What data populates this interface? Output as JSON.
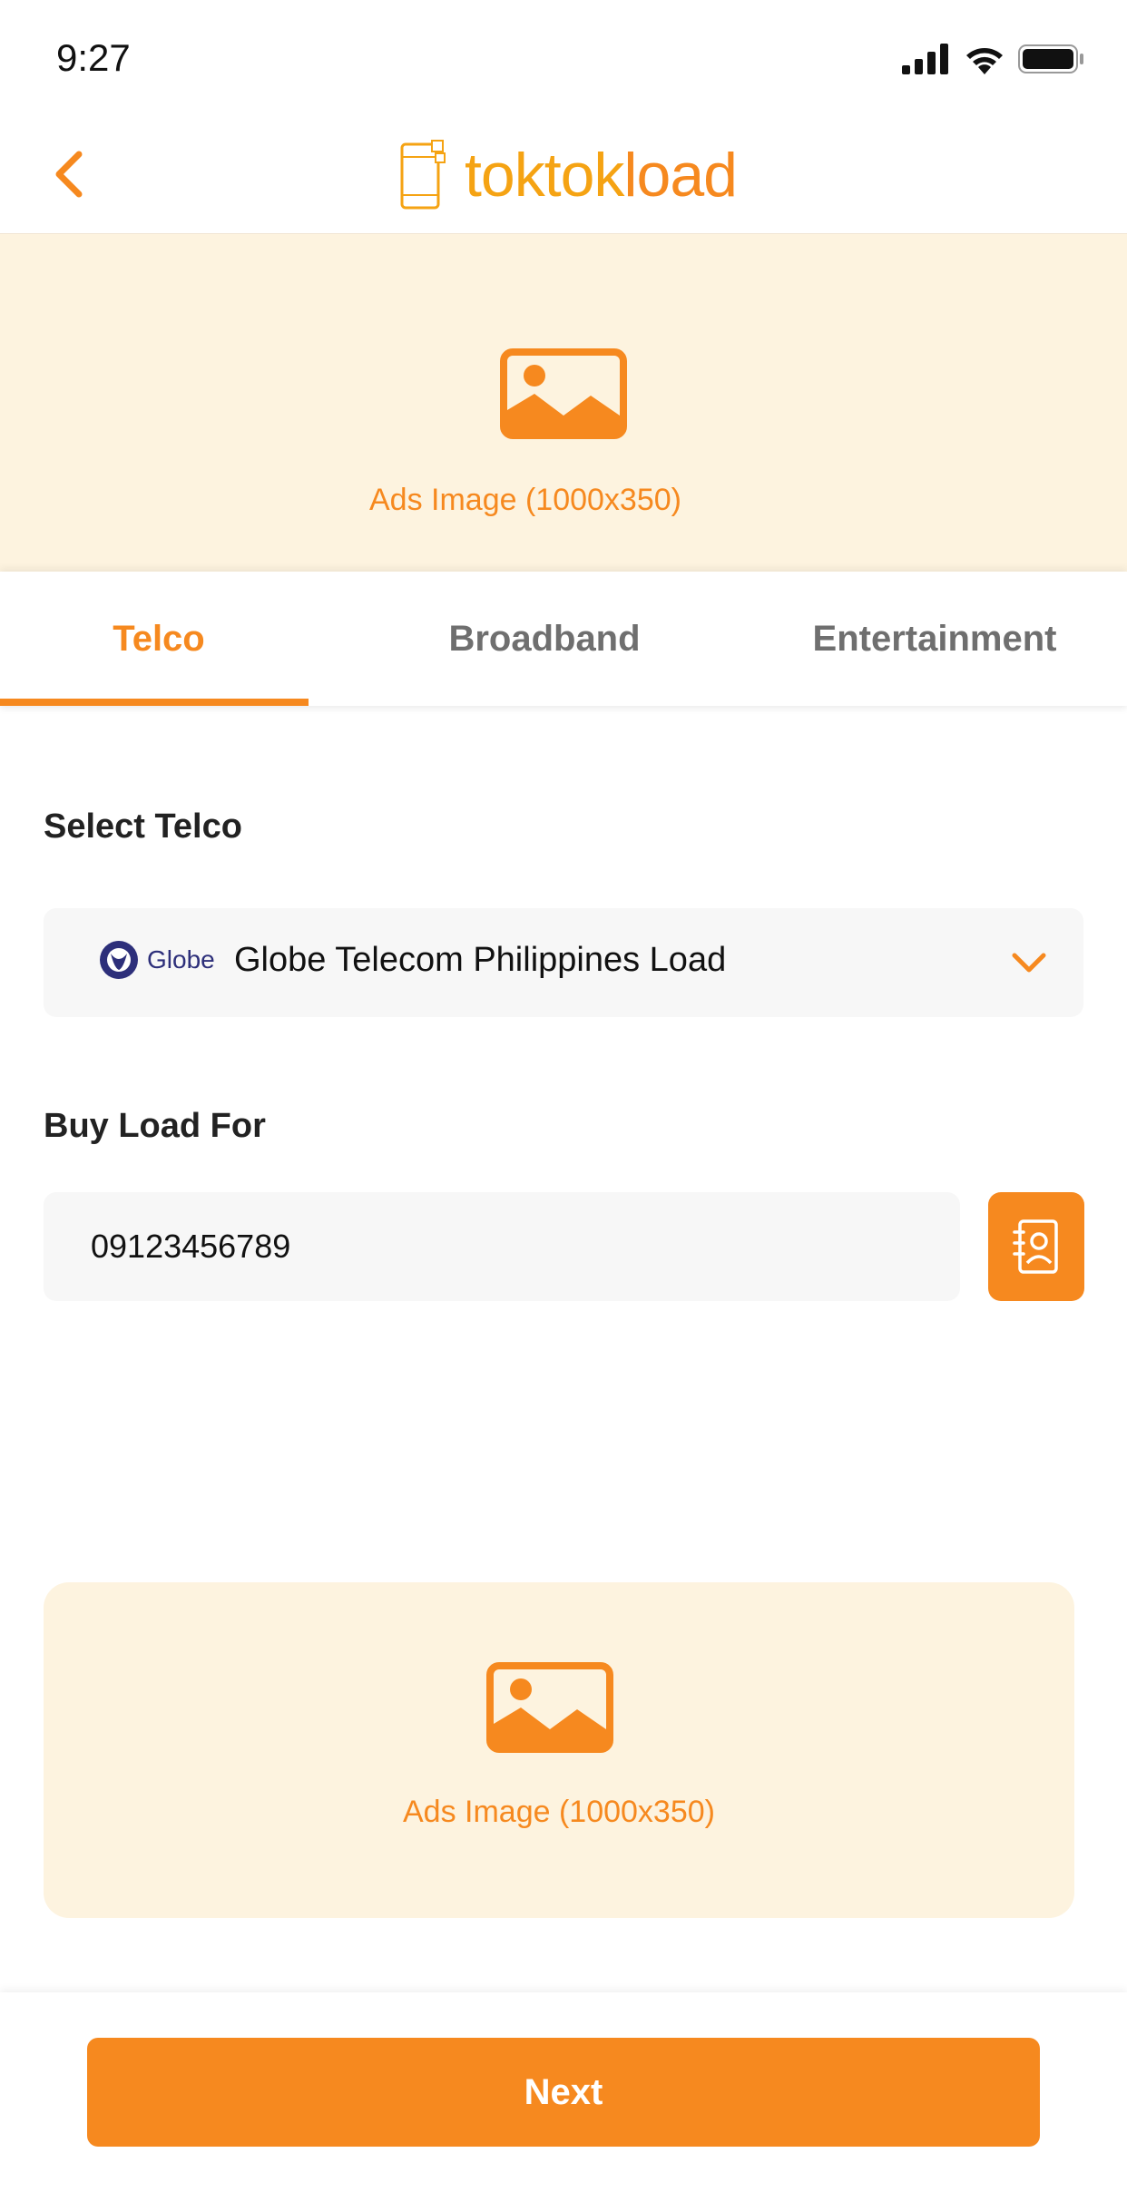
{
  "status_bar": {
    "time": "9:27",
    "icons": [
      "signal-icon",
      "wifi-icon",
      "battery-icon"
    ]
  },
  "header": {
    "back_icon": "chevron-left-icon",
    "logo_part1": "toktok",
    "logo_part2": "load"
  },
  "ads": {
    "top_label": "Ads Image (1000x350)",
    "bottom_label": "Ads Image (1000x350)",
    "icon": "image-icon"
  },
  "tabs": [
    {
      "label": "Telco",
      "active": true
    },
    {
      "label": "Broadband",
      "active": false
    },
    {
      "label": "Entertainment",
      "active": false
    }
  ],
  "form": {
    "telco_label": "Select Telco",
    "telco_brand": "Globe",
    "telco_value": "Globe Telecom Philippines Load",
    "buy_for_label": "Buy Load For",
    "phone_value": "09123456789",
    "contacts_icon": "contact-book-icon"
  },
  "footer": {
    "next_label": "Next"
  },
  "colors": {
    "accent": "#f6891f",
    "logo_yellow": "#f5a313",
    "ad_bg": "#fdf3df",
    "field_bg": "#f7f7f7",
    "globe_blue": "#2d2f7a"
  }
}
